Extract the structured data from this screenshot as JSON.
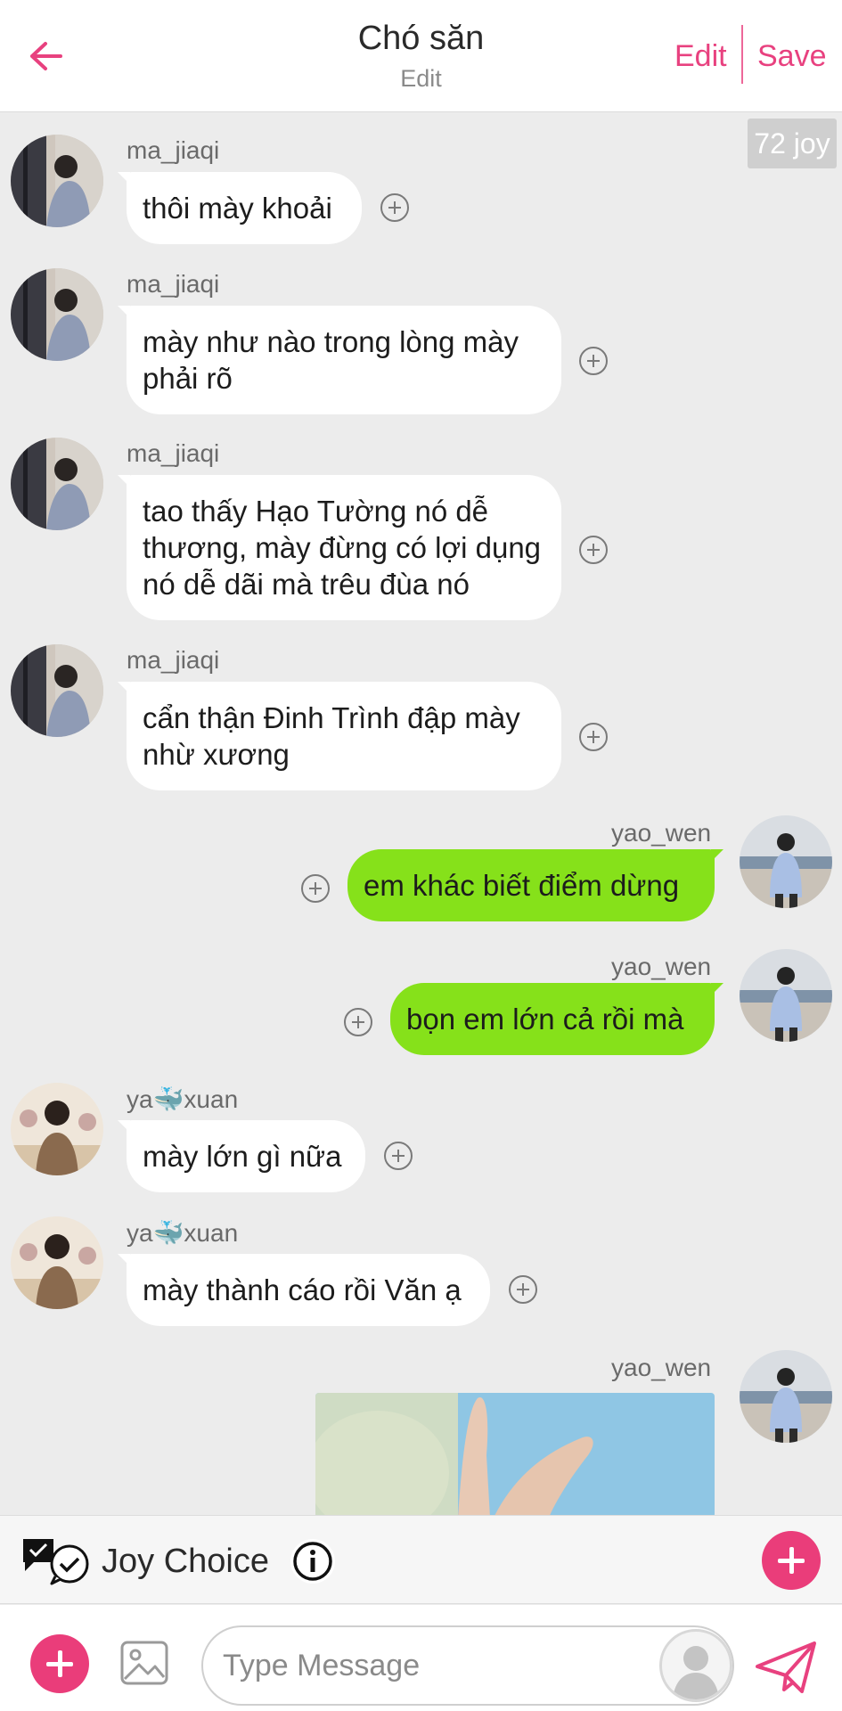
{
  "header": {
    "back_icon": "arrow-left-icon",
    "title": "Chó săn",
    "subtitle": "Edit",
    "edit_label": "Edit",
    "save_label": "Save",
    "accent_color": "#e8417f"
  },
  "chat": {
    "joy_badge": "72 joy",
    "messages": [
      {
        "sender": "ma_jiaqi",
        "side": "in",
        "text": "thôi mày khoải"
      },
      {
        "sender": "ma_jiaqi",
        "side": "in",
        "text": "mày như nào trong lòng mày phải rõ"
      },
      {
        "sender": "ma_jiaqi",
        "side": "in",
        "text": "tao thấy Hạo Tường nó dễ thương, mày đừng có lợi dụng nó dễ dãi mà trêu đùa nó"
      },
      {
        "sender": "ma_jiaqi",
        "side": "in",
        "text": "cẩn thận Đinh Trình đập mày nhừ xương"
      },
      {
        "sender": "yao_wen",
        "side": "out",
        "text": "em khác biết điểm dừng"
      },
      {
        "sender": "yao_wen",
        "side": "out",
        "text": "bọn em lớn cả rồi mà"
      },
      {
        "sender": "ya🐳xuan",
        "side": "in",
        "text": "mày lớn gì nữa"
      },
      {
        "sender": "ya🐳xuan",
        "side": "in",
        "text": "mày thành cáo rồi Văn ạ"
      },
      {
        "sender": "yao_wen",
        "side": "out",
        "text": ""
      }
    ]
  },
  "joybar": {
    "label": "Joy Choice",
    "icon": "chat-check-icon",
    "info_icon": "info-icon"
  },
  "composer": {
    "placeholder": "Type Message",
    "image_icon": "image-icon",
    "send_icon": "send-icon"
  },
  "colors": {
    "outgoing_bubble": "#86e11a",
    "incoming_bubble": "#ffffff",
    "pink": "#ea3d7a"
  }
}
